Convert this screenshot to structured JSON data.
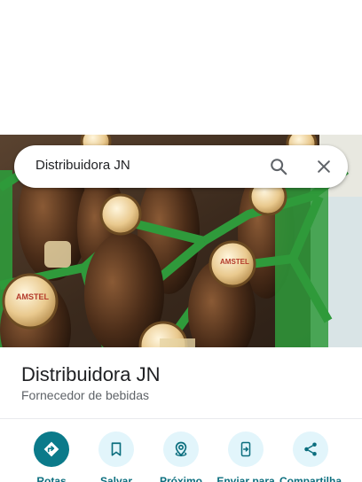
{
  "search": {
    "query": "Distribuidora JN",
    "search_icon": "search-icon",
    "close_icon": "close-icon"
  },
  "place": {
    "name": "Distribuidora JN",
    "category": "Fornecedor de bebidas",
    "photo_label": "AMSTEL"
  },
  "actions": [
    {
      "label": "Rotas",
      "icon": "directions-icon"
    },
    {
      "label": "Salvar",
      "icon": "bookmark-icon"
    },
    {
      "label": "Próximo",
      "icon": "nearby-icon"
    },
    {
      "label": "Enviar para",
      "icon": "send-to-phone-icon"
    },
    {
      "label": "Compartilha",
      "icon": "share-icon"
    }
  ],
  "colors": {
    "accent": "#0b7a8a",
    "action_bg": "#e2f5fb",
    "label": "#0b6e7e",
    "crate": "#2f9a3b"
  }
}
